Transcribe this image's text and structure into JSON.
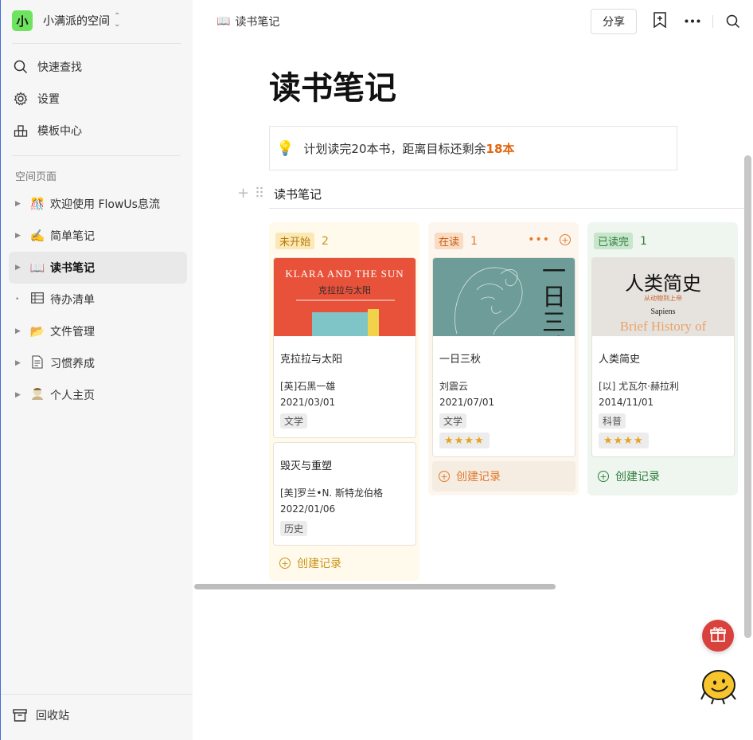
{
  "workspace": {
    "avatar": "小",
    "name": "小满派的空间"
  },
  "sidebar": {
    "quick": [
      {
        "label": "快速查找",
        "icon": "search-icon"
      },
      {
        "label": "设置",
        "icon": "gear-icon"
      },
      {
        "label": "模板中心",
        "icon": "template-icon"
      }
    ],
    "section_label": "空间页面",
    "pages": [
      {
        "emoji": "🎊",
        "label": "欢迎使用 FlowUs息流",
        "arrow": "▶"
      },
      {
        "emoji": "✍️",
        "label": "简单笔记",
        "arrow": "▶"
      },
      {
        "emoji": "📖",
        "label": "读书笔记",
        "arrow": "▶"
      },
      {
        "emoji": "",
        "label": "待办清单",
        "arrow": "•"
      },
      {
        "emoji": "📂",
        "label": "文件管理",
        "arrow": "▶"
      },
      {
        "emoji": "",
        "label": "习惯养成",
        "arrow": "▶"
      },
      {
        "emoji": "",
        "label": "个人主页",
        "arrow": "▶"
      }
    ],
    "trash": "回收站"
  },
  "topbar": {
    "crumb_emoji": "📖",
    "crumb": "读书笔记",
    "share": "分享"
  },
  "page": {
    "title": "读书笔记",
    "callout_text": "计划读完20本书，距离目标还剩余",
    "callout_highlight": "18本",
    "view_title": "读书笔记"
  },
  "board": {
    "new_record": "创建记录",
    "columns": [
      {
        "status": "未开始",
        "count": "2",
        "cards": [
          {
            "title": "克拉拉与太阳",
            "author": "[英]石黑一雄",
            "date": "2021/03/01",
            "tag": "文学",
            "cover_title": "KLARA AND THE SUN",
            "cover_sub": "克拉拉与太阳"
          },
          {
            "title": "毁灭与重塑",
            "author": "[美]罗兰•N. 斯特龙伯格",
            "date": "2022/01/06",
            "tag": "历史"
          }
        ]
      },
      {
        "status": "在读",
        "count": "1",
        "cards": [
          {
            "title": "一日三秋",
            "author": "刘震云",
            "date": "2021/07/01",
            "tag": "文学",
            "stars": "★★★★",
            "cover_title": "一日三秋"
          }
        ]
      },
      {
        "status": "已读完",
        "count": "1",
        "cards": [
          {
            "title": "人类简史",
            "author": "[以] 尤瓦尔·赫拉利",
            "date": "2014/11/01",
            "tag": "科普",
            "stars": "★★★★",
            "cover_title": "人类简史",
            "cover_sub": "从动物到上帝",
            "cover_en1": "Sapiens",
            "cover_en2": "Brief History of"
          }
        ]
      }
    ]
  }
}
